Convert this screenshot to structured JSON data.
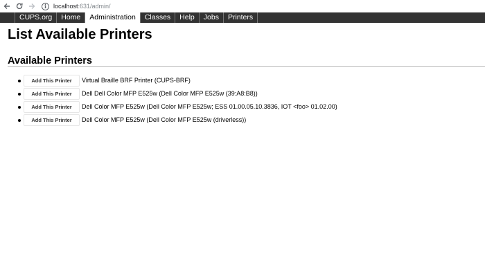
{
  "browser": {
    "url_host": "localhost",
    "url_rest": ":631/admin/",
    "info_icon": "info-icon"
  },
  "nav": {
    "tabs": [
      {
        "label": "CUPS.org",
        "active": false
      },
      {
        "label": "Home",
        "active": false
      },
      {
        "label": "Administration",
        "active": true
      },
      {
        "label": "Classes",
        "active": false
      },
      {
        "label": "Help",
        "active": false
      },
      {
        "label": "Jobs",
        "active": false
      },
      {
        "label": "Printers",
        "active": false
      }
    ]
  },
  "main": {
    "title": "List Available Printers",
    "section_title": "Available Printers",
    "add_button_label": "Add This Printer",
    "printers": [
      {
        "name": "Virtual Braille BRF Printer (CUPS-BRF)"
      },
      {
        "name": "Dell Dell Color MFP E525w (Dell Color MFP E525w (39:A8:B8))"
      },
      {
        "name": "Dell Color MFP E525w (Dell Color MFP E525w; ESS 01.00.05.10.3836, IOT <foo> 01.02.00)"
      },
      {
        "name": "Dell Color MFP E525w (Dell Color MFP E525w (driverless))"
      }
    ]
  },
  "colors": {
    "nav_background": "#333333",
    "nav_active_background": "#ffffff",
    "nav_text": "#ffffff"
  }
}
